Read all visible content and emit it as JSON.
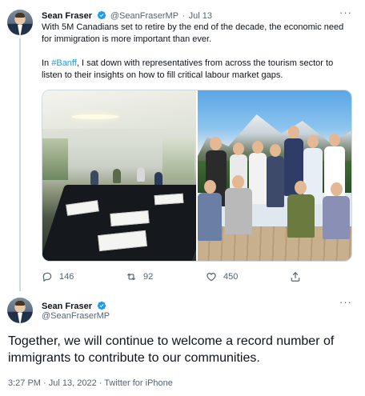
{
  "reply_tweet": {
    "author_name": "Sean Fraser",
    "handle": "@SeanFraserMP",
    "separator": "·",
    "date": "Jul 13",
    "text_line1": "With 5M Canadians set to retire by the end of the decade, the economic need for immigration is more important than ever.",
    "text_p2_prefix": "In ",
    "hashtag": "#Banff",
    "text_p2_suffix": ", I sat down with representatives from across the tourism sector to listen to their insights on how to fill critical labour market gaps.",
    "replies": "146",
    "retweets": "92",
    "likes": "450"
  },
  "main_tweet": {
    "author_name": "Sean Fraser",
    "handle": "@SeanFraserMP",
    "text": "Together, we will continue to welcome a record number of immigrants to contribute to our communities.",
    "time": "3:27 PM",
    "date": "Jul 13, 2022",
    "separator": "·",
    "source": "Twitter for iPhone"
  },
  "colors": {
    "accent": "#1d9bf0",
    "text": "#0f1419",
    "muted": "#536471",
    "border": "#cfd9de"
  },
  "icons": [
    "verified-badge-icon",
    "more-options-icon",
    "reply-icon",
    "retweet-icon",
    "like-icon",
    "share-icon"
  ]
}
